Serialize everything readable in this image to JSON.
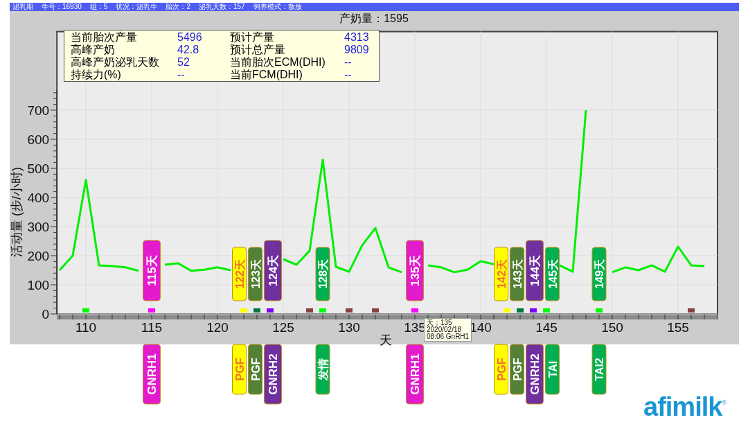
{
  "header": [
    "泌乳期",
    "牛号：16930",
    "组：5",
    "状况：泌乳牛",
    "胎次：2",
    "泌乳天数：157",
    "饲养模式：散放"
  ],
  "title": "产奶量：1595",
  "summary": [
    {
      "label": "当前胎次产量",
      "value": "5496"
    },
    {
      "label": "预计产量",
      "value": "4313"
    },
    {
      "label": "高峰产奶",
      "value": "42.8"
    },
    {
      "label": "预计总产量",
      "value": "9809"
    },
    {
      "label": "高峰产奶泌乳天数",
      "value": "52"
    },
    {
      "label": "当前胎次ECM(DHI)",
      "value": "--"
    },
    {
      "label": "持续力(%)",
      "value": "--"
    },
    {
      "label": "当前FCM(DHI)",
      "value": "--"
    }
  ],
  "chart_data": {
    "type": "line",
    "xlabel": "天",
    "ylabel": "活动量 (步/小时)",
    "xlim": [
      107.8,
      158
    ],
    "ylim": [
      0,
      970
    ],
    "grid": true,
    "xticks": [
      110,
      115,
      120,
      125,
      130,
      135,
      140,
      145,
      150,
      155
    ],
    "yticks": [
      0,
      100,
      200,
      300,
      400,
      500,
      600,
      700
    ],
    "x": [
      108,
      109,
      110,
      111,
      112,
      113,
      114,
      115,
      116,
      117,
      118,
      119,
      120,
      121,
      122,
      123,
      124,
      125,
      126,
      127,
      128,
      129,
      130,
      131,
      132,
      133,
      134,
      135,
      136,
      137,
      138,
      139,
      140,
      141,
      142,
      143,
      144,
      145,
      146,
      147,
      148,
      149,
      150,
      151,
      152,
      153,
      154,
      155,
      156,
      157
    ],
    "series": [
      {
        "color": "#00ee00",
        "values": [
          150,
          200,
          460,
          167,
          164,
          160,
          148,
          null,
          169,
          174,
          148,
          152,
          160,
          150,
          null,
          null,
          null,
          188,
          169,
          217,
          530,
          162,
          145,
          236,
          295,
          160,
          143,
          null,
          167,
          160,
          143,
          152,
          181,
          171,
          null,
          null,
          null,
          null,
          167,
          145,
          700,
          null,
          143,
          160,
          150,
          167,
          145,
          231,
          167,
          164
        ]
      },
      {
        "type": "scatter",
        "color": "#00ff00",
        "values": [
          null,
          null,
          12,
          null,
          null,
          null,
          null,
          null,
          null,
          null,
          null,
          null,
          null,
          null,
          null,
          null,
          null,
          null,
          null,
          null,
          12,
          null,
          null,
          null,
          null,
          null,
          null,
          null,
          null,
          null,
          null,
          null,
          null,
          null,
          null,
          null,
          null,
          12,
          null,
          null,
          null,
          12,
          null,
          null,
          null,
          null,
          null,
          null,
          null,
          null
        ]
      },
      {
        "type": "scatter",
        "color": "#ff00ff",
        "values": [
          null,
          null,
          null,
          null,
          null,
          null,
          null,
          12,
          null,
          null,
          null,
          null,
          null,
          null,
          null,
          null,
          null,
          null,
          null,
          null,
          null,
          null,
          null,
          null,
          null,
          null,
          null,
          12,
          null,
          null,
          null,
          null,
          null,
          null,
          null,
          null,
          null,
          null,
          null,
          null,
          null,
          null,
          null,
          null,
          null,
          null,
          null,
          null,
          null,
          null
        ]
      },
      {
        "type": "scatter",
        "color": "#ffff00",
        "values": [
          null,
          null,
          null,
          null,
          null,
          null,
          null,
          null,
          null,
          null,
          null,
          null,
          null,
          null,
          12,
          null,
          null,
          null,
          null,
          null,
          null,
          null,
          null,
          null,
          null,
          null,
          null,
          null,
          null,
          null,
          null,
          null,
          null,
          null,
          12,
          null,
          null,
          null,
          null,
          null,
          null,
          null,
          null,
          null,
          null,
          null,
          null,
          null,
          null,
          null
        ]
      },
      {
        "type": "scatter",
        "color": "#007a40",
        "values": [
          null,
          null,
          null,
          null,
          null,
          null,
          null,
          null,
          null,
          null,
          null,
          null,
          null,
          null,
          null,
          12,
          null,
          null,
          null,
          null,
          null,
          null,
          null,
          null,
          null,
          null,
          null,
          null,
          null,
          null,
          null,
          null,
          null,
          null,
          null,
          12,
          null,
          null,
          null,
          null,
          null,
          null,
          null,
          null,
          null,
          null,
          null,
          null,
          null,
          null
        ]
      },
      {
        "type": "scatter",
        "color": "#8000ff",
        "values": [
          null,
          null,
          null,
          null,
          null,
          null,
          null,
          null,
          null,
          null,
          null,
          null,
          null,
          null,
          null,
          null,
          12,
          null,
          null,
          null,
          null,
          null,
          null,
          null,
          null,
          null,
          null,
          null,
          null,
          null,
          null,
          null,
          null,
          null,
          null,
          null,
          12,
          null,
          null,
          null,
          null,
          null,
          null,
          null,
          null,
          null,
          null,
          null,
          null,
          null
        ]
      },
      {
        "type": "scatter",
        "color": "#8b4040",
        "values": [
          null,
          null,
          null,
          null,
          null,
          null,
          null,
          null,
          null,
          null,
          null,
          null,
          null,
          null,
          null,
          null,
          null,
          null,
          null,
          12,
          null,
          null,
          12,
          null,
          12,
          null,
          null,
          null,
          null,
          null,
          null,
          null,
          null,
          null,
          null,
          null,
          null,
          null,
          null,
          null,
          null,
          null,
          null,
          null,
          null,
          null,
          null,
          null,
          12,
          null
        ]
      }
    ],
    "annotations": [
      {
        "x": 115,
        "y": 12,
        "text": "115天"
      },
      {
        "x": 122,
        "y": 12,
        "text": "122天"
      },
      {
        "x": 123,
        "y": 12,
        "text": "123天"
      },
      {
        "x": 124,
        "y": 12,
        "text": "124天"
      },
      {
        "x": 128,
        "y": 12,
        "text": "128天"
      },
      {
        "x": 135,
        "y": 12,
        "text": "135天"
      },
      {
        "x": 142,
        "y": 12,
        "text": "142天"
      },
      {
        "x": 143,
        "y": 12,
        "text": "143天"
      },
      {
        "x": 144,
        "y": 12,
        "text": "144天"
      },
      {
        "x": 145,
        "y": 12,
        "text": "145天"
      },
      {
        "x": 149,
        "y": 12,
        "text": "149天"
      }
    ]
  },
  "events": [
    {
      "treatment": "GNRH1",
      "color": "#e31bcc"
    },
    {
      "treatment": "PGF",
      "color": "#ffff00"
    },
    {
      "treatment": "PGF",
      "color": "#538135"
    },
    {
      "treatment": "GNRH2",
      "color": "#7030a0"
    },
    {
      "treatment": "发情",
      "color": "#00b050"
    },
    {
      "treatment": "GNRH1",
      "color": "#e31bcc"
    },
    {
      "treatment": "PGF",
      "color": "#ffff00"
    },
    {
      "treatment": "PGF",
      "color": "#538135"
    },
    {
      "treatment": "GNRH2",
      "color": "#7030a0"
    },
    {
      "treatment": "TAI",
      "color": "#00b050"
    },
    {
      "treatment": "TAI2",
      "color": "#00b050"
    }
  ],
  "tooltip": {
    "lines": [
      "天：135",
      "2020/02/18",
      "08:06 GnRH1"
    ]
  },
  "logo": {
    "text": "afimilk",
    "mark": "®"
  }
}
